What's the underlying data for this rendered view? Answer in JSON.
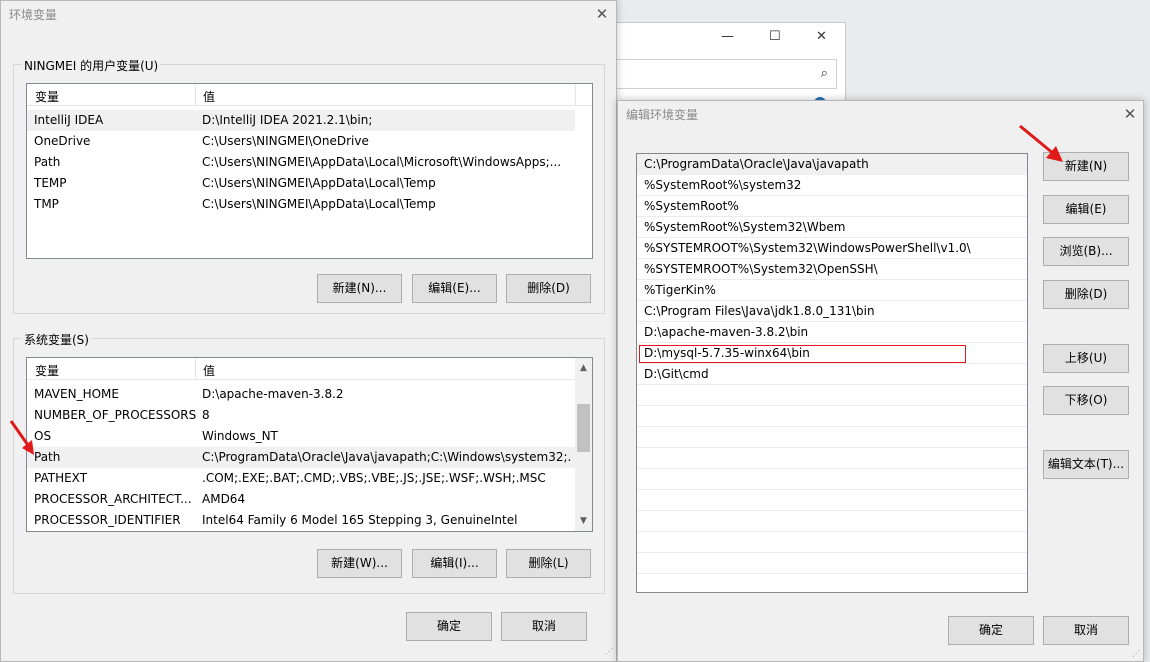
{
  "env_dialog": {
    "title": "环境变量",
    "close_glyph": "✕",
    "user_vars": {
      "label": "NINGMEI 的用户变量(U)",
      "col_var": "变量",
      "col_val": "值",
      "rows": [
        {
          "name": "IntelliJ IDEA",
          "value": "D:\\IntelliJ IDEA 2021.2.1\\bin;"
        },
        {
          "name": "OneDrive",
          "value": "C:\\Users\\NINGMEI\\OneDrive"
        },
        {
          "name": "Path",
          "value": "C:\\Users\\NINGMEI\\AppData\\Local\\Microsoft\\WindowsApps;..."
        },
        {
          "name": "TEMP",
          "value": "C:\\Users\\NINGMEI\\AppData\\Local\\Temp"
        },
        {
          "name": "TMP",
          "value": "C:\\Users\\NINGMEI\\AppData\\Local\\Temp"
        }
      ],
      "btn_new": "新建(N)...",
      "btn_edit": "编辑(E)...",
      "btn_delete": "删除(D)"
    },
    "sys_vars": {
      "label": "系统变量(S)",
      "col_var": "变量",
      "col_val": "值",
      "rows": [
        {
          "name": "MAVEN_HOME",
          "value": "D:\\apache-maven-3.8.2"
        },
        {
          "name": "NUMBER_OF_PROCESSORS",
          "value": "8"
        },
        {
          "name": "OS",
          "value": "Windows_NT"
        },
        {
          "name": "Path",
          "value": "C:\\ProgramData\\Oracle\\Java\\javapath;C:\\Windows\\system32;..."
        },
        {
          "name": "PATHEXT",
          "value": ".COM;.EXE;.BAT;.CMD;.VBS;.VBE;.JS;.JSE;.WSF;.WSH;.MSC"
        },
        {
          "name": "PROCESSOR_ARCHITECT...",
          "value": "AMD64"
        },
        {
          "name": "PROCESSOR_IDENTIFIER",
          "value": "Intel64 Family 6 Model 165 Stepping 3, GenuineIntel"
        }
      ],
      "btn_new": "新建(W)...",
      "btn_edit": "编辑(I)...",
      "btn_delete": "删除(L)"
    },
    "btn_ok": "确定",
    "btn_cancel": "取消"
  },
  "explorer_window": {
    "minimize_glyph": "—",
    "maximize_glyph": "☐",
    "close_glyph": "✕",
    "search_glyph": "⌕"
  },
  "edit_dialog": {
    "title": "编辑环境变量",
    "close_glyph": "✕",
    "paths": [
      "C:\\ProgramData\\Oracle\\Java\\javapath",
      "%SystemRoot%\\system32",
      "%SystemRoot%",
      "%SystemRoot%\\System32\\Wbem",
      "%SYSTEMROOT%\\System32\\WindowsPowerShell\\v1.0\\",
      "%SYSTEMROOT%\\System32\\OpenSSH\\",
      "%TigerKin%",
      "C:\\Program Files\\Java\\jdk1.8.0_131\\bin",
      "D:\\apache-maven-3.8.2\\bin",
      "D:\\mysql-5.7.35-winx64\\bin",
      "D:\\Git\\cmd"
    ],
    "btn_new": "新建(N)",
    "btn_edit": "编辑(E)",
    "btn_browse": "浏览(B)...",
    "btn_delete": "删除(D)",
    "btn_up": "上移(U)",
    "btn_down": "下移(O)",
    "btn_edit_text": "编辑文本(T)...",
    "btn_ok": "确定",
    "btn_cancel": "取消"
  },
  "colors": {
    "annotation_red": "#e0191b",
    "dialog_bg": "#f0f0f0",
    "button_bg": "#e1e1e1"
  }
}
